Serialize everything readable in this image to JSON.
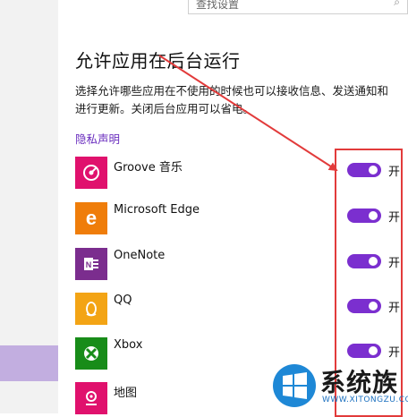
{
  "search": {
    "text": "查找设置",
    "icon": "search-icon"
  },
  "page": {
    "title": "允许应用在后台运行",
    "description": "选择允许哪些应用在不使用的时候也可以接收信息、发送通知和进行更新。关闭后台应用可以省电。",
    "privacy_link": "隐私声明"
  },
  "apps": [
    {
      "name": "Groove 音乐",
      "icon": "groove-music-icon",
      "color": "#e0116d",
      "toggle_label": "开",
      "on": true
    },
    {
      "name": "Microsoft Edge",
      "icon": "edge-icon",
      "color": "#ef7d0a",
      "toggle_label": "开",
      "on": true
    },
    {
      "name": "OneNote",
      "icon": "onenote-icon",
      "color": "#7b2d8e",
      "toggle_label": "开",
      "on": true
    },
    {
      "name": "QQ",
      "icon": "qq-icon",
      "color": "#f3a415",
      "toggle_label": "开",
      "on": true
    },
    {
      "name": "Xbox",
      "icon": "xbox-icon",
      "color": "#188c19",
      "toggle_label": "开",
      "on": true
    },
    {
      "name": "地图",
      "icon": "maps-icon",
      "color": "#e0116d",
      "toggle_label": "",
      "on": true
    }
  ],
  "colors": {
    "accent": "#7b2fcf",
    "annotation": "#e23b3b",
    "highlight": "#c2aee0"
  },
  "watermark": {
    "text": "系统族",
    "url": "WWW.XITONGZU.COM",
    "icon": "windows-logo-icon"
  }
}
